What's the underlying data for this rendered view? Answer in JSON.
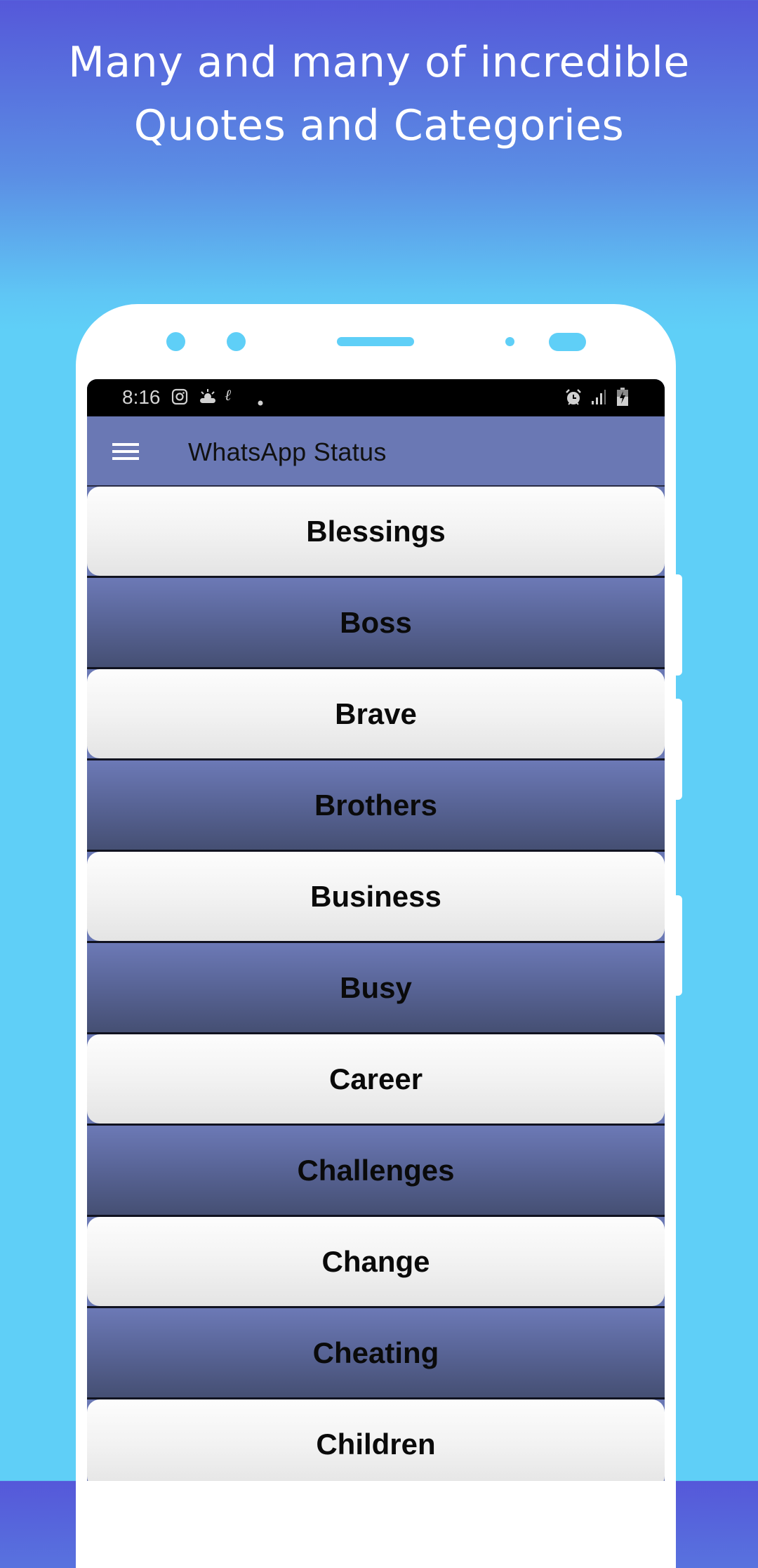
{
  "promo": {
    "headline_line1": "Many and many of incredible",
    "headline_line2": "Quotes and Categories"
  },
  "colors": {
    "background_top": "#5558d9",
    "background_bottom": "#5fcff7",
    "app_bar": "#6a78b4",
    "dark_row_top": "#6c79b6",
    "dark_row_bottom": "#454f73",
    "light_row_top": "#fdfdfd",
    "light_row_bottom": "#e4e4e4"
  },
  "status_bar": {
    "time": "8:16",
    "left_icons": [
      "instagram-icon",
      "weather-icon",
      "app-notification-icon",
      "more-notifications-dot"
    ],
    "right_icons": [
      "alarm-icon",
      "signal-icon",
      "battery-charging-icon"
    ]
  },
  "app_bar": {
    "menu_icon": "hamburger-menu-icon",
    "title": "WhatsApp Status"
  },
  "categories": [
    {
      "label": "Blessings",
      "style": "light"
    },
    {
      "label": "Boss",
      "style": "dark"
    },
    {
      "label": "Brave",
      "style": "light"
    },
    {
      "label": "Brothers",
      "style": "dark"
    },
    {
      "label": "Business",
      "style": "light"
    },
    {
      "label": "Busy",
      "style": "dark"
    },
    {
      "label": "Career",
      "style": "light"
    },
    {
      "label": "Challenges",
      "style": "dark"
    },
    {
      "label": "Change",
      "style": "light"
    },
    {
      "label": "Cheating",
      "style": "dark"
    },
    {
      "label": "Children",
      "style": "light"
    }
  ]
}
